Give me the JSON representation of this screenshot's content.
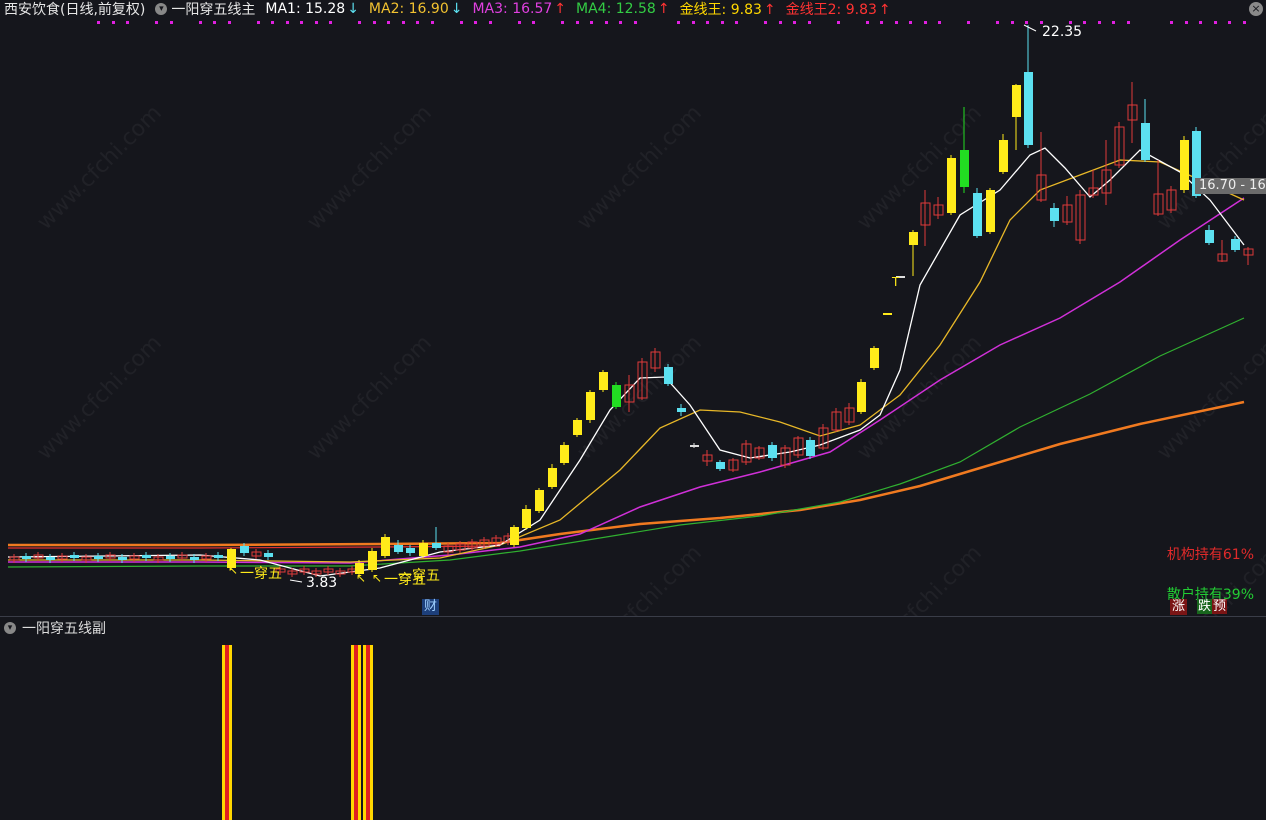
{
  "header": {
    "stock_title": "西安饮食(日线,前复权)",
    "indicator_name": "一阳穿五线主",
    "ma1": {
      "label": "MA1: 15.28",
      "arrow": "↓",
      "color": "#ffffff"
    },
    "ma2": {
      "label": "MA2: 16.90",
      "arrow": "↓",
      "color": "#f2c230"
    },
    "ma3": {
      "label": "MA3: 16.57",
      "arrow": "↑",
      "color": "#e040e0"
    },
    "ma4": {
      "label": "MA4: 12.58",
      "arrow": "↑",
      "color": "#33cc44"
    },
    "gold1": {
      "label": "金线王: 9.83",
      "arrow": "↑",
      "color": "#ffd700"
    },
    "gold2": {
      "label": "金线王2: 9.83",
      "arrow": "↑",
      "color": "#ff3333"
    }
  },
  "annotations": {
    "peak_price": "22.35",
    "low_price": "3.83",
    "cross_label_1": "一穿五",
    "cross_label_2": "一穿五",
    "cross_label_3": "一穿五",
    "last_price_text": "16.70 - 16",
    "t_mark": "T",
    "finance_badge": "财"
  },
  "holdings": {
    "institutional": "机构持有61%",
    "retail": "散户持有39%",
    "rise_badge": "涨",
    "fall_badge_a": "跌",
    "fall_badge_b": "预"
  },
  "sub_panel": {
    "title": "一阳穿五线副"
  },
  "watermark": "www.cfchi.com",
  "colors": {
    "background": "#15161c",
    "up": "#e03a3a",
    "down": "#5ce0f0",
    "signal_yellow": "#ffeb1a",
    "signal_green": "#22dd22",
    "ma_white": "#ffffff",
    "ma_gold": "#e8b828",
    "ma_magenta": "#d030d8",
    "ma_green": "#30b030",
    "ma_orange": "#f07a20",
    "dots_magenta": "#e020e0"
  },
  "icons": {
    "collapse": "chevron-down-icon",
    "corner": "close-icon"
  }
}
